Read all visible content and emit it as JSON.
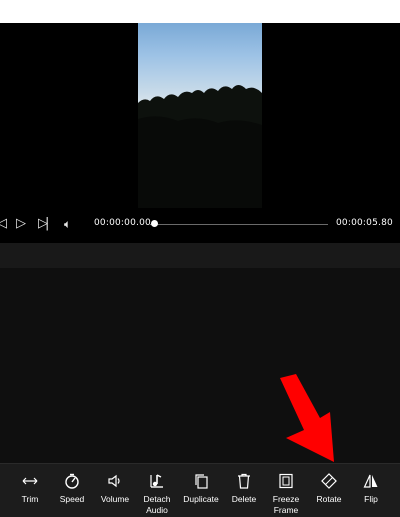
{
  "player": {
    "current_time": "00:00:00.00",
    "total_time": "00:00:05.80",
    "progress": 0.0
  },
  "toolbar": {
    "items": [
      {
        "label": "Trim",
        "icon": "trim-icon"
      },
      {
        "label": "Speed",
        "icon": "speed-icon"
      },
      {
        "label": "Volume",
        "icon": "volume-icon"
      },
      {
        "label": "Detach Audio",
        "icon": "detach-audio-icon"
      },
      {
        "label": "Duplicate",
        "icon": "duplicate-icon"
      },
      {
        "label": "Delete",
        "icon": "delete-icon"
      },
      {
        "label": "Freeze Frame",
        "icon": "freeze-frame-icon"
      },
      {
        "label": "Rotate",
        "icon": "rotate-icon"
      },
      {
        "label": "Flip",
        "icon": "flip-icon"
      }
    ]
  },
  "colors": {
    "annotation_arrow": "#ff0000",
    "background": "#0d0d0d",
    "toolbar_bg": "#1c1c1c"
  }
}
